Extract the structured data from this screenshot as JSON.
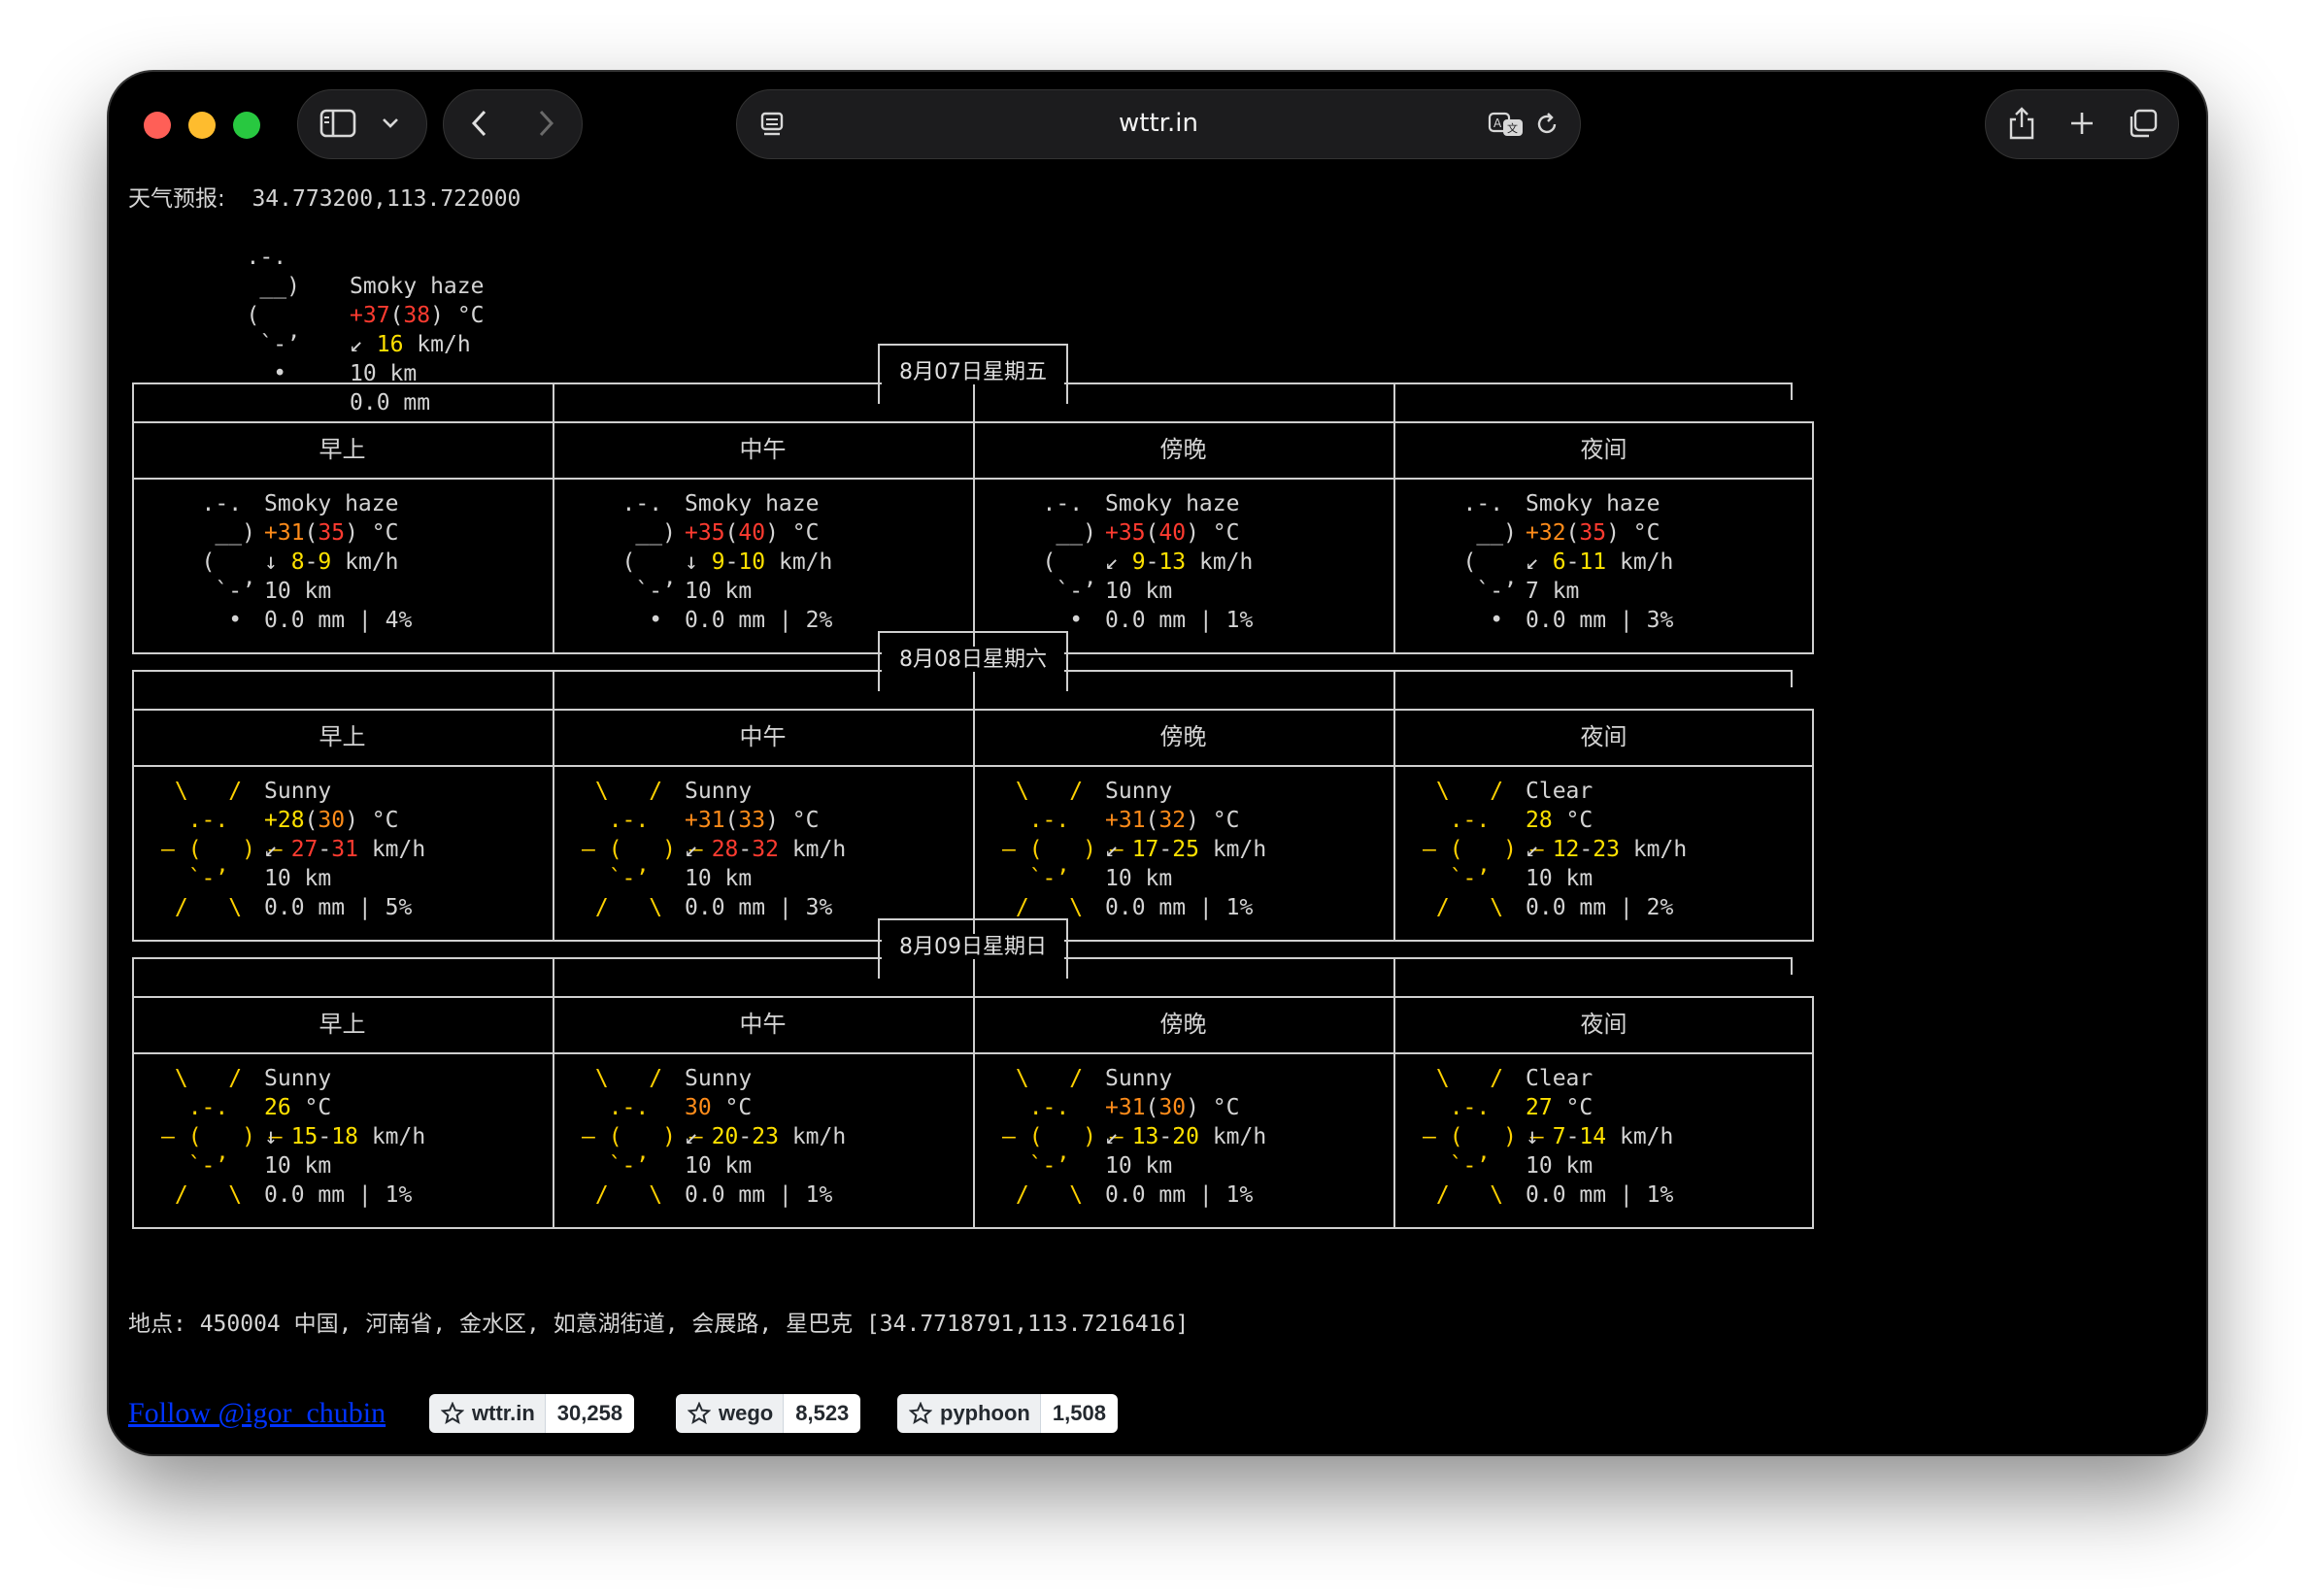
{
  "browser": {
    "url": "wttr.in"
  },
  "header": {
    "label": "天气预报:",
    "coords": "34.773200,113.722000"
  },
  "current": {
    "icon": [
      "   .-.",
      "    __)",
      "   (",
      "    `-’",
      "     •"
    ],
    "condition": "Smoky haze",
    "temp": "+37",
    "feels": "38",
    "wind_dir": "↙",
    "wind": "16",
    "visibility": "10 km",
    "precip": "0.0 mm"
  },
  "periods": [
    "早上",
    "中午",
    "傍晚",
    "夜间"
  ],
  "days": [
    {
      "date": "8月07日星期五",
      "cells": [
        {
          "icon": "haze",
          "condition": "Smoky haze",
          "temp": "+31",
          "feels": "35",
          "wind_dir": "↓",
          "wind_lo": "8",
          "wind_hi": "9",
          "visibility": "10 km",
          "precip": "0.0 mm | 4%"
        },
        {
          "icon": "haze",
          "condition": "Smoky haze",
          "temp": "+35",
          "feels": "40",
          "wind_dir": "↓",
          "wind_lo": "9",
          "wind_hi": "10",
          "visibility": "10 km",
          "precip": "0.0 mm | 2%"
        },
        {
          "icon": "haze",
          "condition": "Smoky haze",
          "temp": "+35",
          "feels": "40",
          "wind_dir": "↙",
          "wind_lo": "9",
          "wind_hi": "13",
          "visibility": "10 km",
          "precip": "0.0 mm | 1%"
        },
        {
          "icon": "haze",
          "condition": "Smoky haze",
          "temp": "+32",
          "feels": "35",
          "wind_dir": "↙",
          "wind_lo": "6",
          "wind_hi": "11",
          "visibility": "7 km",
          "precip": "0.0 mm | 3%"
        }
      ]
    },
    {
      "date": "8月08日星期六",
      "cells": [
        {
          "icon": "sun",
          "condition": "Sunny",
          "temp": "+28",
          "feels": "30",
          "wind_dir": "↙",
          "wind_lo": "27",
          "wind_hi": "31",
          "visibility": "10 km",
          "precip": "0.0 mm | 5%"
        },
        {
          "icon": "sun",
          "condition": "Sunny",
          "temp": "+31",
          "feels": "33",
          "wind_dir": "↙",
          "wind_lo": "28",
          "wind_hi": "32",
          "visibility": "10 km",
          "precip": "0.0 mm | 3%"
        },
        {
          "icon": "sun",
          "condition": "Sunny",
          "temp": "+31",
          "feels": "32",
          "wind_dir": "↙",
          "wind_lo": "17",
          "wind_hi": "25",
          "visibility": "10 km",
          "precip": "0.0 mm | 1%"
        },
        {
          "icon": "sun",
          "condition": "Clear",
          "temp": "28",
          "feels": "",
          "wind_dir": "↙",
          "wind_lo": "12",
          "wind_hi": "23",
          "visibility": "10 km",
          "precip": "0.0 mm | 2%"
        }
      ]
    },
    {
      "date": "8月09日星期日",
      "cells": [
        {
          "icon": "sun",
          "condition": "Sunny",
          "temp": "26",
          "feels": "",
          "wind_dir": "↓",
          "wind_lo": "15",
          "wind_hi": "18",
          "visibility": "10 km",
          "precip": "0.0 mm | 1%"
        },
        {
          "icon": "sun",
          "condition": "Sunny",
          "temp": "30",
          "feels": "",
          "wind_dir": "↙",
          "wind_lo": "20",
          "wind_hi": "23",
          "visibility": "10 km",
          "precip": "0.0 mm | 1%"
        },
        {
          "icon": "sun",
          "condition": "Sunny",
          "temp": "+31",
          "feels": "30",
          "wind_dir": "↙",
          "wind_lo": "13",
          "wind_hi": "20",
          "visibility": "10 km",
          "precip": "0.0 mm | 1%"
        },
        {
          "icon": "sun",
          "condition": "Clear",
          "temp": "27",
          "feels": "",
          "wind_dir": "↓",
          "wind_lo": "7",
          "wind_hi": "14",
          "visibility": "10 km",
          "precip": "0.0 mm | 1%"
        }
      ]
    }
  ],
  "units": {
    "temp": "°C",
    "wind": "km/h"
  },
  "location": "地点: 450004 中国, 河南省, 金水区, 如意湖街道, 会展路, 星巴克 [34.7718791,113.7216416]",
  "footer": {
    "follow": "Follow @igor_chubin",
    "badges": [
      {
        "name": "wttr.in",
        "count": "30,258"
      },
      {
        "name": "wego",
        "count": "8,523"
      },
      {
        "name": "pyphoon",
        "count": "1,508"
      }
    ]
  },
  "colors": {
    "hot": "#ff3b30",
    "warm": "#ff8c1a",
    "wind": "#ffe100",
    "sun": "#ffd100"
  }
}
